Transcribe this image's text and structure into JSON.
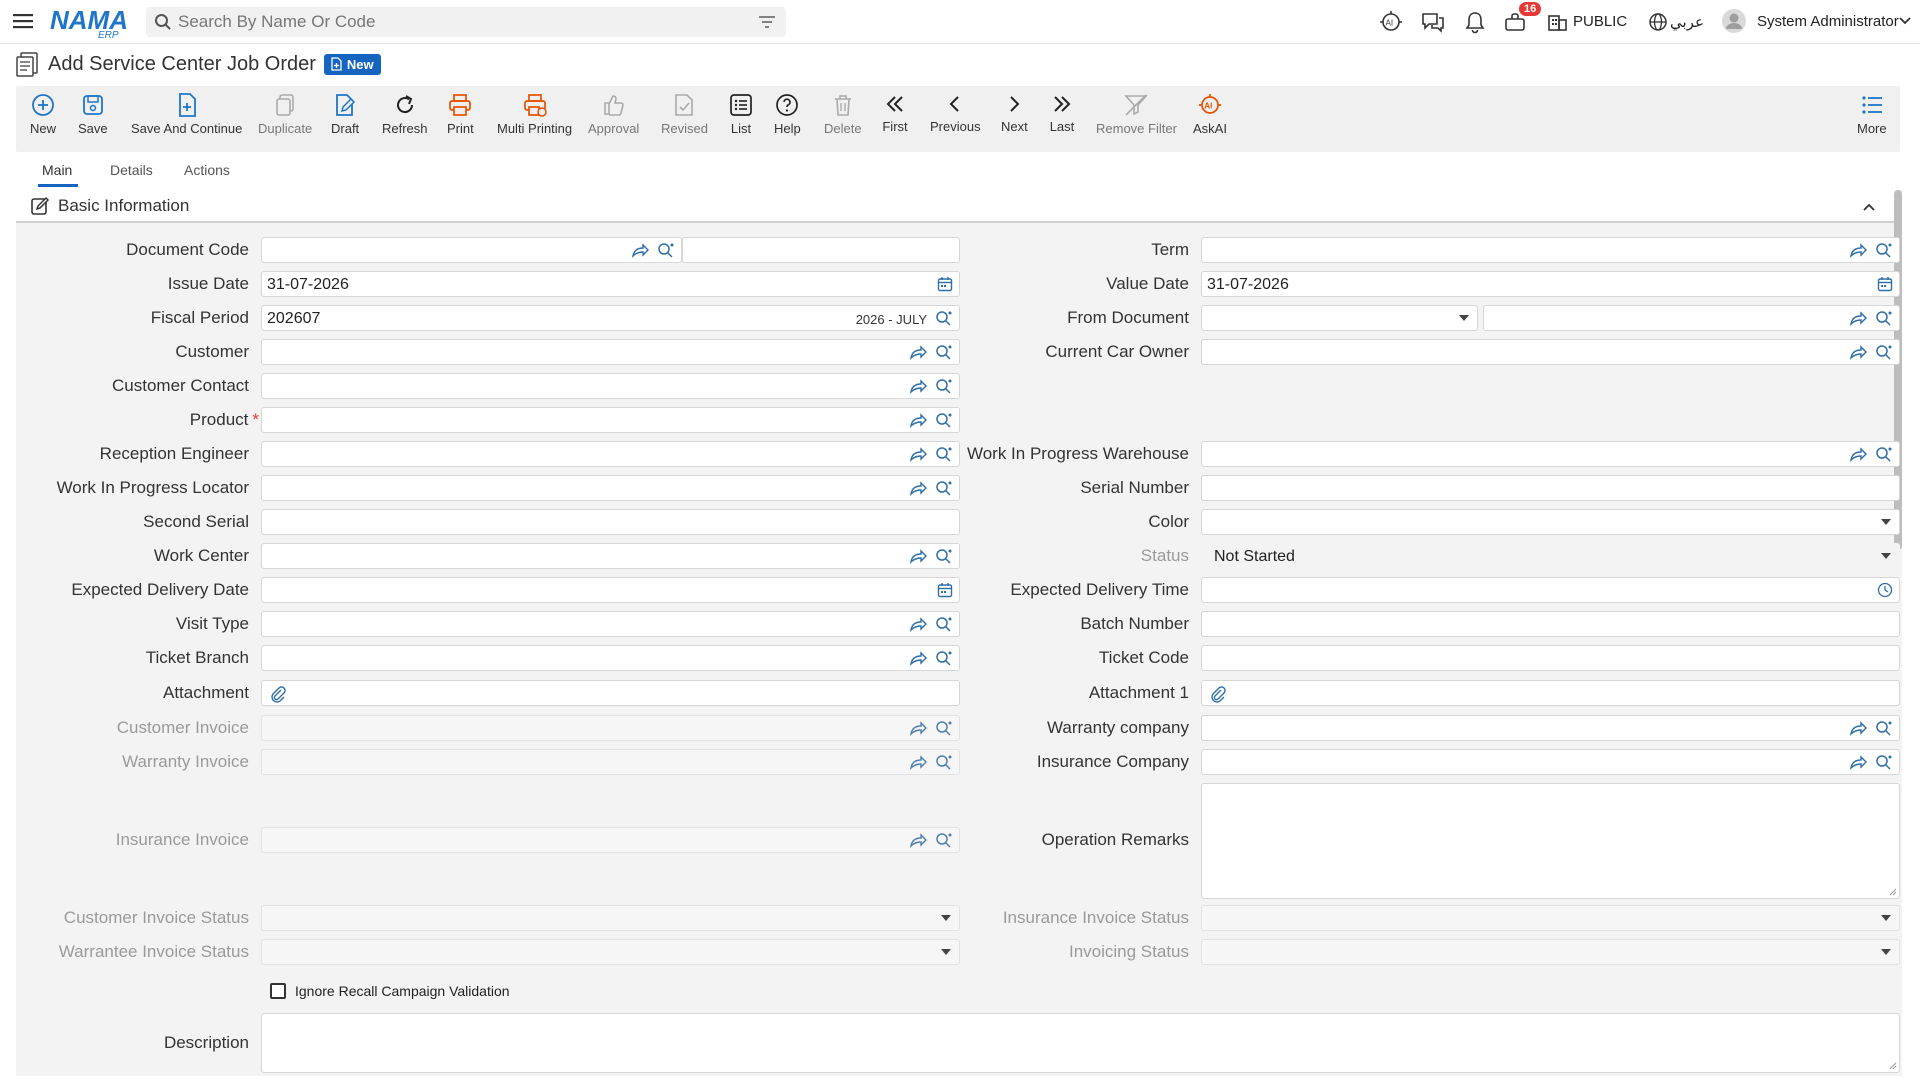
{
  "header": {
    "search_placeholder": "Search By Name Or Code",
    "notification_count": "16",
    "company": "PUBLIC",
    "language": "عربي",
    "user": "System Administrator"
  },
  "page": {
    "title": "Add Service Center Job Order",
    "mode_badge": "New"
  },
  "toolbar": {
    "new": "New",
    "save": "Save",
    "save_continue": "Save And Continue",
    "duplicate": "Duplicate",
    "draft": "Draft",
    "refresh": "Refresh",
    "print": "Print",
    "multi_printing": "Multi Printing",
    "approval": "Approval",
    "revised": "Revised",
    "list": "List",
    "help": "Help",
    "delete": "Delete",
    "first": "First",
    "previous": "Previous",
    "next": "Next",
    "last": "Last",
    "remove_filter": "Remove Filter",
    "ask_ai": "AskAI",
    "more": "More"
  },
  "tabs": [
    "Main",
    "Details",
    "Actions"
  ],
  "section": {
    "title": "Basic Information"
  },
  "form": {
    "left": {
      "document_code": {
        "label": "Document Code",
        "value": ""
      },
      "issue_date": {
        "label": "Issue Date",
        "value": "31-07-2026"
      },
      "fiscal_period": {
        "label": "Fiscal Period",
        "value": "202607",
        "display": "2026 - JULY"
      },
      "customer": {
        "label": "Customer",
        "value": ""
      },
      "customer_contact": {
        "label": "Customer Contact",
        "value": ""
      },
      "product": {
        "label": "Product",
        "required_mark": "*",
        "value": ""
      },
      "reception_engineer": {
        "label": "Reception Engineer",
        "value": ""
      },
      "wip_locator": {
        "label": "Work In Progress Locator",
        "value": ""
      },
      "second_serial": {
        "label": "Second Serial",
        "value": ""
      },
      "work_center": {
        "label": "Work Center",
        "value": ""
      },
      "expected_delivery_date": {
        "label": "Expected Delivery Date",
        "value": ""
      },
      "visit_type": {
        "label": "Visit Type",
        "value": ""
      },
      "ticket_branch": {
        "label": "Ticket Branch",
        "value": ""
      },
      "attachment": {
        "label": "Attachment",
        "value": ""
      },
      "customer_invoice": {
        "label": "Customer Invoice",
        "value": ""
      },
      "warranty_invoice": {
        "label": "Warranty Invoice",
        "value": ""
      },
      "insurance_invoice": {
        "label": "Insurance Invoice",
        "value": ""
      },
      "customer_invoice_status": {
        "label": "Customer Invoice Status",
        "value": ""
      },
      "warrantee_invoice_status": {
        "label": "Warrantee Invoice Status",
        "value": ""
      }
    },
    "right": {
      "term": {
        "label": "Term",
        "value": ""
      },
      "value_date": {
        "label": "Value Date",
        "value": "31-07-2026"
      },
      "from_document": {
        "label": "From Document",
        "value": ""
      },
      "current_car_owner": {
        "label": "Current Car Owner",
        "value": ""
      },
      "wip_warehouse": {
        "label": "Work In Progress Warehouse",
        "value": ""
      },
      "serial_number": {
        "label": "Serial Number",
        "value": ""
      },
      "color": {
        "label": "Color",
        "value": ""
      },
      "status": {
        "label": "Status",
        "value": "Not Started"
      },
      "expected_delivery_time": {
        "label": "Expected Delivery Time",
        "value": ""
      },
      "batch_number": {
        "label": "Batch Number",
        "value": ""
      },
      "ticket_code": {
        "label": "Ticket Code",
        "value": ""
      },
      "attachment_1": {
        "label": "Attachment 1",
        "value": ""
      },
      "warranty_company": {
        "label": "Warranty company",
        "value": ""
      },
      "insurance_company": {
        "label": "Insurance Company",
        "value": ""
      },
      "operation_remarks": {
        "label": "Operation Remarks",
        "value": ""
      },
      "insurance_invoice_status": {
        "label": "Insurance Invoice Status",
        "value": ""
      },
      "invoicing_status": {
        "label": "Invoicing Status",
        "value": ""
      }
    },
    "ignore_recall": {
      "label": "Ignore Recall Campaign Validation",
      "checked": false
    },
    "description": {
      "label": "Description",
      "value": ""
    }
  }
}
